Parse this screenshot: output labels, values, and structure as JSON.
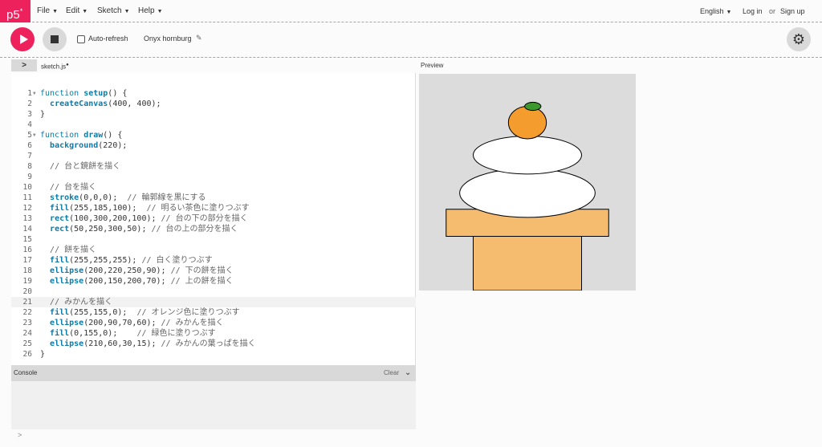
{
  "app": {
    "logo": "p5",
    "logo_mark": "*"
  },
  "menu": {
    "file": "File",
    "edit": "Edit",
    "sketch": "Sketch",
    "help": "Help"
  },
  "account": {
    "language": "English",
    "login": "Log in",
    "or": "or",
    "signup": "Sign up"
  },
  "toolbar": {
    "auto_refresh": "Auto-refresh",
    "project_name": "Onyx hornburg"
  },
  "editor": {
    "filename": "sketch.js",
    "unsaved_marker": "●",
    "lines": [
      {
        "n": "1",
        "fold": true,
        "parts": [
          [
            "kw",
            "function "
          ],
          [
            "fn",
            "setup"
          ],
          [
            "pl",
            "() {"
          ]
        ]
      },
      {
        "n": "2",
        "parts": [
          [
            "pl",
            "  "
          ],
          [
            "fn",
            "createCanvas"
          ],
          [
            "pl",
            "(400, 400);"
          ]
        ]
      },
      {
        "n": "3",
        "parts": [
          [
            "pl",
            "}"
          ]
        ]
      },
      {
        "n": "4",
        "parts": []
      },
      {
        "n": "5",
        "fold": true,
        "parts": [
          [
            "kw",
            "function "
          ],
          [
            "fn",
            "draw"
          ],
          [
            "pl",
            "() {"
          ]
        ]
      },
      {
        "n": "6",
        "parts": [
          [
            "pl",
            "  "
          ],
          [
            "fn",
            "background"
          ],
          [
            "pl",
            "(220);"
          ]
        ]
      },
      {
        "n": "7",
        "parts": []
      },
      {
        "n": "8",
        "parts": [
          [
            "pl",
            "  "
          ],
          [
            "cm",
            "// 台と鏡餅を描く"
          ]
        ]
      },
      {
        "n": "9",
        "parts": []
      },
      {
        "n": "10",
        "parts": [
          [
            "pl",
            "  "
          ],
          [
            "cm",
            "// 台を描く"
          ]
        ]
      },
      {
        "n": "11",
        "parts": [
          [
            "pl",
            "  "
          ],
          [
            "fn",
            "stroke"
          ],
          [
            "pl",
            "(0,0,0);  "
          ],
          [
            "cm",
            "// 輪郭線を黒にする"
          ]
        ]
      },
      {
        "n": "12",
        "parts": [
          [
            "pl",
            "  "
          ],
          [
            "fn",
            "fill"
          ],
          [
            "pl",
            "(255,185,100);  "
          ],
          [
            "cm",
            "// 明るい茶色に塗りつぶす"
          ]
        ]
      },
      {
        "n": "13",
        "parts": [
          [
            "pl",
            "  "
          ],
          [
            "fn",
            "rect"
          ],
          [
            "pl",
            "(100,300,200,100); "
          ],
          [
            "cm",
            "// 台の下の部分を描く"
          ]
        ]
      },
      {
        "n": "14",
        "parts": [
          [
            "pl",
            "  "
          ],
          [
            "fn",
            "rect"
          ],
          [
            "pl",
            "(50,250,300,50); "
          ],
          [
            "cm",
            "// 台の上の部分を描く"
          ]
        ]
      },
      {
        "n": "15",
        "parts": []
      },
      {
        "n": "16",
        "parts": [
          [
            "pl",
            "  "
          ],
          [
            "cm",
            "// 餅を描く"
          ]
        ]
      },
      {
        "n": "17",
        "parts": [
          [
            "pl",
            "  "
          ],
          [
            "fn",
            "fill"
          ],
          [
            "pl",
            "(255,255,255); "
          ],
          [
            "cm",
            "// 白く塗りつぶす"
          ]
        ]
      },
      {
        "n": "18",
        "parts": [
          [
            "pl",
            "  "
          ],
          [
            "fn",
            "ellipse"
          ],
          [
            "pl",
            "(200,220,250,90); "
          ],
          [
            "cm",
            "// 下の餅を描く"
          ]
        ]
      },
      {
        "n": "19",
        "parts": [
          [
            "pl",
            "  "
          ],
          [
            "fn",
            "ellipse"
          ],
          [
            "pl",
            "(200,150,200,70); "
          ],
          [
            "cm",
            "// 上の餅を描く"
          ]
        ]
      },
      {
        "n": "20",
        "parts": []
      },
      {
        "n": "21",
        "active": true,
        "parts": [
          [
            "pl",
            "  "
          ],
          [
            "cm",
            "// みかんを描く"
          ]
        ]
      },
      {
        "n": "22",
        "parts": [
          [
            "pl",
            "  "
          ],
          [
            "fn",
            "fill"
          ],
          [
            "pl",
            "(255,155,0);  "
          ],
          [
            "cm",
            "// オレンジ色に塗りつぶす"
          ]
        ]
      },
      {
        "n": "23",
        "parts": [
          [
            "pl",
            "  "
          ],
          [
            "fn",
            "ellipse"
          ],
          [
            "pl",
            "(200,90,70,60); "
          ],
          [
            "cm",
            "// みかんを描く"
          ]
        ]
      },
      {
        "n": "24",
        "parts": [
          [
            "pl",
            "  "
          ],
          [
            "fn",
            "fill"
          ],
          [
            "pl",
            "(0,155,0);    "
          ],
          [
            "cm",
            "// 緑色に塗りつぶす"
          ]
        ]
      },
      {
        "n": "25",
        "parts": [
          [
            "pl",
            "  "
          ],
          [
            "fn",
            "ellipse"
          ],
          [
            "pl",
            "(210,60,30,15); "
          ],
          [
            "cm",
            "// みかんの葉っぱを描く"
          ]
        ]
      },
      {
        "n": "26",
        "parts": [
          [
            "pl",
            "}"
          ]
        ]
      }
    ]
  },
  "console": {
    "title": "Console",
    "clear": "Clear",
    "prompt": ">"
  },
  "preview": {
    "label": "Preview",
    "background": "#dcdcdc",
    "base_color": "#f5bc6f",
    "mochi_color": "#ffffff",
    "mikan_color": "#f59c2e",
    "leaf_color": "#3c9a2c"
  },
  "colors": {
    "accent": "#ed225d"
  }
}
